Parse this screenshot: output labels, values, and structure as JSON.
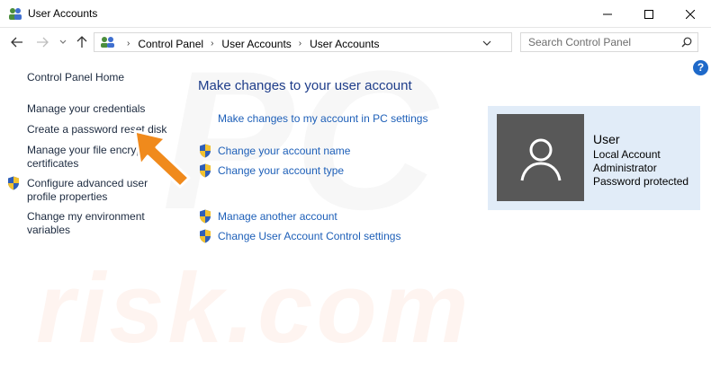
{
  "window": {
    "title": "User Accounts"
  },
  "address": {
    "crumbs": [
      "Control Panel",
      "User Accounts",
      "User Accounts"
    ]
  },
  "search": {
    "placeholder": "Search Control Panel"
  },
  "help": {
    "label": "?"
  },
  "left_nav": {
    "home": "Control Panel Home",
    "items": [
      "Manage your credentials",
      "Create a password reset disk",
      "Manage your file encryption",
      "certificates",
      "Configure advanced user",
      "profile properties",
      "Change my environment",
      "variables"
    ]
  },
  "main": {
    "heading": "Make changes to your user account",
    "links": [
      "Make changes to my account in PC settings",
      "Change your account name",
      "Change your account type",
      "Manage another account",
      "Change User Account Control settings"
    ]
  },
  "user": {
    "name": "User",
    "lines": [
      "Local Account",
      "Administrator",
      "Password protected"
    ]
  },
  "watermark": {
    "text": "risk.com",
    "pc": "PC"
  },
  "colors": {
    "link": "#1d5fb8",
    "heading": "#1e3d8a",
    "card_bg": "#e1ecf8",
    "avatar_bg": "#585858",
    "arrow": "#f08a1c"
  },
  "icons": {
    "app": "users-icon",
    "back": "arrow-left-icon",
    "forward": "arrow-right-icon",
    "recent": "chevron-down-icon",
    "up": "arrow-up-icon",
    "search": "search-icon",
    "refresh": "refresh-icon",
    "shield": "uac-shield-icon"
  }
}
